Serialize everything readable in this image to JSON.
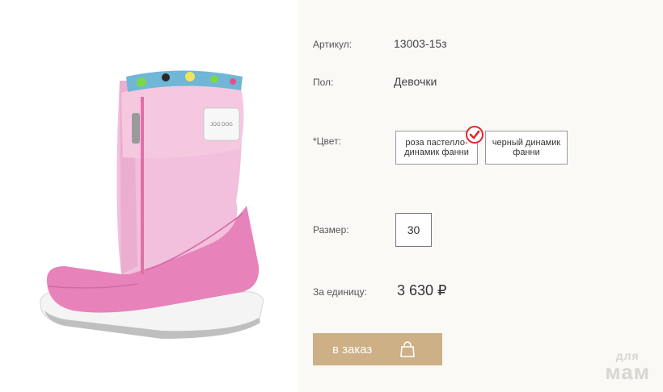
{
  "product": {
    "article_label": "Артикул:",
    "article_value": "13003-15з",
    "gender_label": "Пол:",
    "gender_value": "Девочки",
    "color_label": "*Цвет:",
    "colors": [
      {
        "label": "роза пастелло-динамик фанни",
        "selected": true
      },
      {
        "label": "черный динамик фанни",
        "selected": false
      }
    ],
    "size_label": "Размер:",
    "size_value": "30",
    "price_label": "За единицу:",
    "price_value": "3 630 ₽",
    "order_label": "в заказ"
  },
  "image": {
    "alt": "boot-product-image",
    "brand_tag": "JOG DOG"
  },
  "watermark": {
    "line1": "для",
    "line2": "мам"
  },
  "colors": {
    "accent": "#cdb086",
    "check": "#e0242d",
    "panel_bg": "#faf9f6"
  }
}
